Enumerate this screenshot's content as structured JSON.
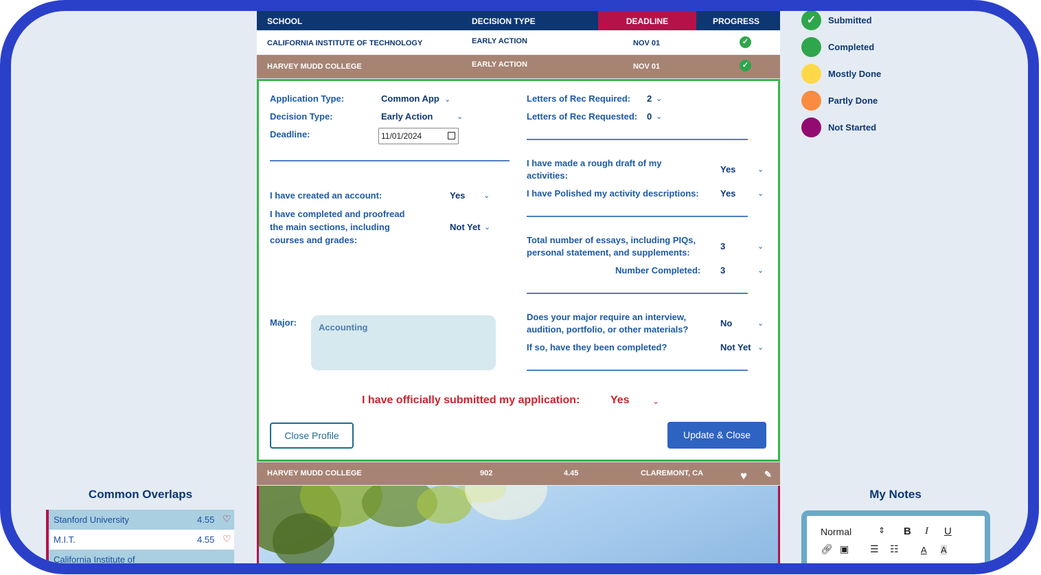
{
  "table": {
    "headers": {
      "school": "SCHOOL",
      "decision_type": "DECISION TYPE",
      "deadline": "DEADLINE",
      "progress": "PROGRESS"
    },
    "rows": [
      {
        "school": "CALIFORNIA INSTITUTE OF TECHNOLOGY",
        "decision_type": "EARLY ACTION",
        "deadline": "NOV 01",
        "progress_icon": "check-circle-icon"
      },
      {
        "school": "HARVEY MUDD COLLEGE",
        "decision_type": "EARLY ACTION",
        "deadline": "NOV 01",
        "progress_icon": "check-circle-icon"
      }
    ]
  },
  "profile": {
    "application_type_label": "Application Type:",
    "application_type_value": "Common App",
    "decision_type_label": "Decision Type:",
    "decision_type_value": "Early Action",
    "deadline_label": "Deadline:",
    "deadline_value": "11/01/2024",
    "letters_required_label": "Letters of Rec Required:",
    "letters_required_value": "2",
    "letters_requested_label": "Letters of Rec Requested:",
    "letters_requested_value": "0",
    "created_account_label": "I have created an account:",
    "created_account_value": "Yes",
    "completed_sections_label_1": "I have completed and proofread",
    "completed_sections_label_2": "the main sections, including",
    "completed_sections_label_3": "courses and grades:",
    "completed_sections_value": "Not Yet",
    "rough_draft_label_1": "I have made a rough draft of my",
    "rough_draft_label_2": "activities:",
    "rough_draft_value": "Yes",
    "polished_label": "I have Polished my activity descriptions:",
    "polished_value": "Yes",
    "essays_label_1": "Total number of essays, including PIQs,",
    "essays_label_2": "personal statement, and supplements:",
    "essays_value": "3",
    "essays_completed_label": "Number Completed:",
    "essays_completed_value": "3",
    "major_label": "Major:",
    "major_value": "Accounting",
    "interview_label_1": "Does your major require an interview,",
    "interview_label_2": "audition, portfolio, or other materials?",
    "interview_value": "No",
    "interview_completed_label": "If so, have they been completed?",
    "interview_completed_value": "Not Yet",
    "submitted_label": "I have officially submitted my application:",
    "submitted_value": "Yes",
    "close_button": "Close Profile",
    "update_button": "Update & Close"
  },
  "school_row": {
    "name": "HARVEY MUDD COLLEGE",
    "number": "902",
    "score": "4.45",
    "location": "CLAREMONT, CA"
  },
  "legend": [
    {
      "label": "Submitted",
      "color": "#2ea64b",
      "icon": "check-icon"
    },
    {
      "label": "Completed",
      "color": "#2ea64b",
      "icon": ""
    },
    {
      "label": "Mostly Done",
      "color": "#ffd84a",
      "icon": ""
    },
    {
      "label": "Partly Done",
      "color": "#f98c40",
      "icon": ""
    },
    {
      "label": "Not Started",
      "color": "#930b71",
      "icon": ""
    }
  ],
  "overlaps": {
    "title": "Common Overlaps",
    "items": [
      {
        "name": "Stanford University",
        "score": "4.55"
      },
      {
        "name": "M.I.T.",
        "score": "4.55"
      },
      {
        "name": "California Institute of",
        "score": ""
      }
    ]
  },
  "notes": {
    "title": "My Notes",
    "format_select": "Normal"
  }
}
